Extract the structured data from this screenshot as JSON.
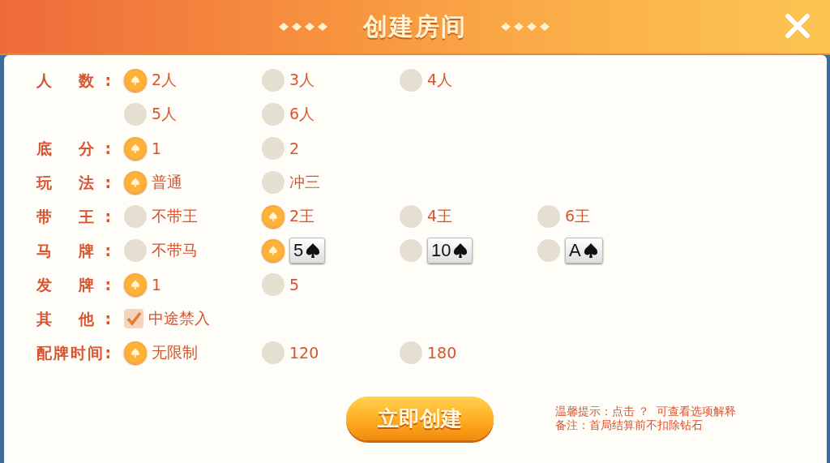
{
  "header": {
    "title": "创建房间"
  },
  "rows": [
    {
      "label": "人 数:",
      "lines": [
        [
          {
            "kind": "radio",
            "text": "2人",
            "selected": true
          },
          {
            "kind": "radio",
            "text": "3人",
            "selected": false
          },
          {
            "kind": "radio",
            "text": "4人",
            "selected": false
          }
        ],
        [
          {
            "kind": "radio",
            "text": "5人",
            "selected": false
          },
          {
            "kind": "radio",
            "text": "6人",
            "selected": false
          }
        ]
      ]
    },
    {
      "label": "底 分:",
      "lines": [
        [
          {
            "kind": "radio",
            "text": "1",
            "selected": true
          },
          {
            "kind": "radio",
            "text": "2",
            "selected": false
          }
        ]
      ]
    },
    {
      "label": "玩 法:",
      "lines": [
        [
          {
            "kind": "radio",
            "text": "普通",
            "selected": true
          },
          {
            "kind": "radio",
            "text": "冲三",
            "selected": false
          }
        ]
      ]
    },
    {
      "label": "带 王:",
      "lines": [
        [
          {
            "kind": "radio",
            "text": "不带王",
            "selected": false
          },
          {
            "kind": "radio",
            "text": "2王",
            "selected": true
          },
          {
            "kind": "radio",
            "text": "4王",
            "selected": false
          },
          {
            "kind": "radio",
            "text": "6王",
            "selected": false
          }
        ]
      ]
    },
    {
      "label": "马 牌:",
      "lines": [
        [
          {
            "kind": "radio",
            "text": "不带马",
            "selected": false
          },
          {
            "kind": "card",
            "rank": "5",
            "selected": true
          },
          {
            "kind": "card",
            "rank": "10",
            "selected": false
          },
          {
            "kind": "card",
            "rank": "A",
            "selected": false
          }
        ]
      ]
    },
    {
      "label": "发 牌:",
      "lines": [
        [
          {
            "kind": "radio",
            "text": "1",
            "selected": true
          },
          {
            "kind": "radio",
            "text": "5",
            "selected": false
          }
        ]
      ]
    },
    {
      "label": "其 他:",
      "lines": [
        [
          {
            "kind": "checkbox",
            "text": "中途禁入",
            "checked": true
          }
        ]
      ]
    },
    {
      "label": "配牌时间:",
      "lines": [
        [
          {
            "kind": "radio",
            "text": "无限制",
            "selected": true
          },
          {
            "kind": "radio",
            "text": "120",
            "selected": false
          },
          {
            "kind": "radio",
            "text": "180",
            "selected": false
          }
        ]
      ]
    }
  ],
  "create_button": "立即创建",
  "notes": [
    "温馨提示：点击 ？  可查看选项解释",
    "备注：首局结算前不扣除钻石"
  ]
}
